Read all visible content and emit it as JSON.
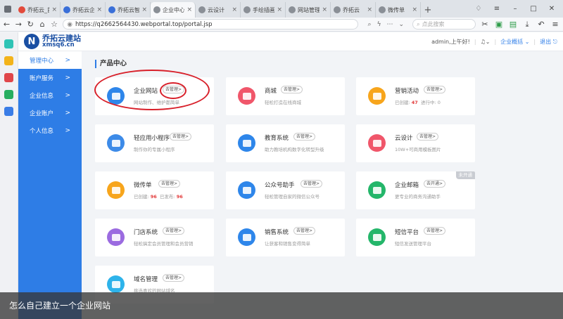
{
  "browser": {
    "tabs": [
      {
        "title": "乔拓云_首",
        "color": "#e24a3b",
        "active": false
      },
      {
        "title": "乔拓云企业",
        "color": "#3a6fd8",
        "active": false
      },
      {
        "title": "乔拓云智能",
        "color": "#3a6fd8",
        "active": false
      },
      {
        "title": "企业中心",
        "color": "#8a8f96",
        "active": true
      },
      {
        "title": "云设计",
        "color": "#8a8f96",
        "active": false
      },
      {
        "title": "手绘插画",
        "color": "#8a8f96",
        "active": false
      },
      {
        "title": "网站管理",
        "color": "#8a8f96",
        "active": false
      },
      {
        "title": "乔拓云",
        "color": "#8a8f96",
        "active": false
      },
      {
        "title": "微传单",
        "color": "#8a8f96",
        "active": false
      }
    ],
    "new_tab": "+",
    "url": "https://q2662564430.webportal.top/portal.jsp",
    "search_placeholder": "点此搜索"
  },
  "header": {
    "logo_letter": "N",
    "logo_title": "乔拓云建站",
    "logo_sub": "xmsq6.cn",
    "greeting": "admin,上午好!",
    "overview": "企业概括",
    "logout": "退出"
  },
  "sidebar": {
    "items": [
      {
        "label": "管理中心",
        "active": true
      },
      {
        "label": "账户服务",
        "active": false
      },
      {
        "label": "企业信息",
        "active": false
      },
      {
        "label": "企业账户",
        "active": false
      },
      {
        "label": "个人信息",
        "active": false
      }
    ],
    "chevron": ">"
  },
  "section_title": "产品中心",
  "manage_label": "去管理>",
  "open_label": "去开通>",
  "cards": [
    {
      "name": "企业网站",
      "desc": "网站制作、维护都简单",
      "color": "#2e86ea"
    },
    {
      "name": "商城",
      "desc": "轻松打造在线商城",
      "color": "#f0566a"
    },
    {
      "name": "营销活动",
      "desc_pre": "已创建:",
      "n1": "47",
      "desc_mid": "进行中:",
      "n2": "0",
      "color": "#f7a51c"
    },
    {
      "name": "轻应用小程序",
      "desc": "制作你的专属小程序",
      "color": "#3d8be8"
    },
    {
      "name": "教育系统",
      "desc": "助力教培机构数字化转型升级",
      "color": "#2e86ea"
    },
    {
      "name": "云设计",
      "desc": "10W+可商用模板图片",
      "color": "#f0566a"
    },
    {
      "name": "微传单",
      "desc_pre": "已创建:",
      "n1": "96",
      "desc_mid": "已发布:",
      "n2": "96",
      "color": "#f7a51c"
    },
    {
      "name": "公众号助手",
      "desc": "轻松管理自家的微信公众号",
      "color": "#2e86ea"
    },
    {
      "name": "企业邮箱",
      "desc": "更专业的商务沟通助手",
      "color": "#24b66a",
      "ribbon": "未开通"
    },
    {
      "name": "门店系统",
      "desc": "轻松搞定会员管理和会员营销",
      "color": "#9b6be0"
    },
    {
      "name": "销售系统",
      "desc": "让获客和销售变得简单",
      "color": "#2e86ea"
    },
    {
      "name": "短信平台",
      "desc": "短信发送管理平台",
      "color": "#24b66a"
    },
    {
      "name": "域名管理",
      "desc": "挑选喜欢的网站域名",
      "color": "#2eb3ea"
    }
  ],
  "caption": "怎么自己建立一个企业网站"
}
